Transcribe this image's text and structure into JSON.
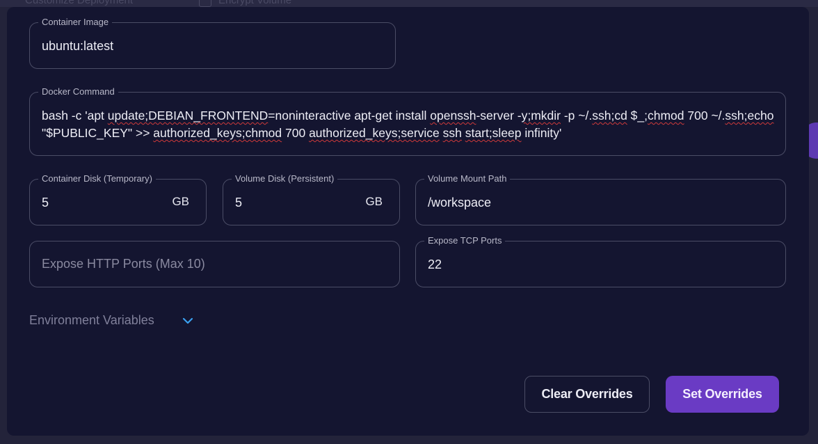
{
  "background": {
    "ghost_left": "Customize Deployment",
    "ghost_right": "Encrypt Volume"
  },
  "form": {
    "container_image": {
      "label": "Container Image",
      "value": "ubuntu:latest"
    },
    "docker_command": {
      "label": "Docker Command",
      "segments": [
        {
          "t": "bash -c 'apt ",
          "sq": false
        },
        {
          "t": "update;DEBIAN_FRONTEND",
          "sq": true
        },
        {
          "t": "=noninteractive apt-get install ",
          "sq": false
        },
        {
          "t": "openssh",
          "sq": true
        },
        {
          "t": "-server -",
          "sq": false
        },
        {
          "t": "y;mkdir",
          "sq": true
        },
        {
          "t": " -p ~/.",
          "sq": false
        },
        {
          "t": "ssh;cd",
          "sq": true
        },
        {
          "t": " $_;",
          "sq": false
        },
        {
          "t": "chmod",
          "sq": true
        },
        {
          "t": " 700 ~/.",
          "sq": false
        },
        {
          "t": "ssh;echo",
          "sq": true
        },
        {
          "t": " \"$PUBLIC_KEY\" >> ",
          "sq": false
        },
        {
          "t": "authorized_keys;chmod",
          "sq": true
        },
        {
          "t": " 700 ",
          "sq": false
        },
        {
          "t": "authorized_keys;service",
          "sq": true
        },
        {
          "t": " ",
          "sq": false
        },
        {
          "t": "ssh",
          "sq": true
        },
        {
          "t": " ",
          "sq": false
        },
        {
          "t": "start;sleep",
          "sq": true
        },
        {
          "t": " infinity'",
          "sq": false
        }
      ]
    },
    "container_disk": {
      "label": "Container Disk (Temporary)",
      "value": "5",
      "unit": "GB"
    },
    "volume_disk": {
      "label": "Volume Disk (Persistent)",
      "value": "5",
      "unit": "GB"
    },
    "volume_mount_path": {
      "label": "Volume Mount Path",
      "value": "/workspace"
    },
    "http_ports": {
      "placeholder": "Expose HTTP Ports (Max 10)"
    },
    "tcp_ports": {
      "label": "Expose TCP Ports",
      "value": "22"
    },
    "env_vars": {
      "label": "Environment Variables",
      "icon": "chevron-down-icon"
    }
  },
  "actions": {
    "clear_label": "Clear Overrides",
    "set_label": "Set Overrides"
  },
  "colors": {
    "modal_bg": "#141530",
    "accent": "#6a3bc4",
    "chevron": "#3aa0ee",
    "border": "#4b4d66"
  }
}
